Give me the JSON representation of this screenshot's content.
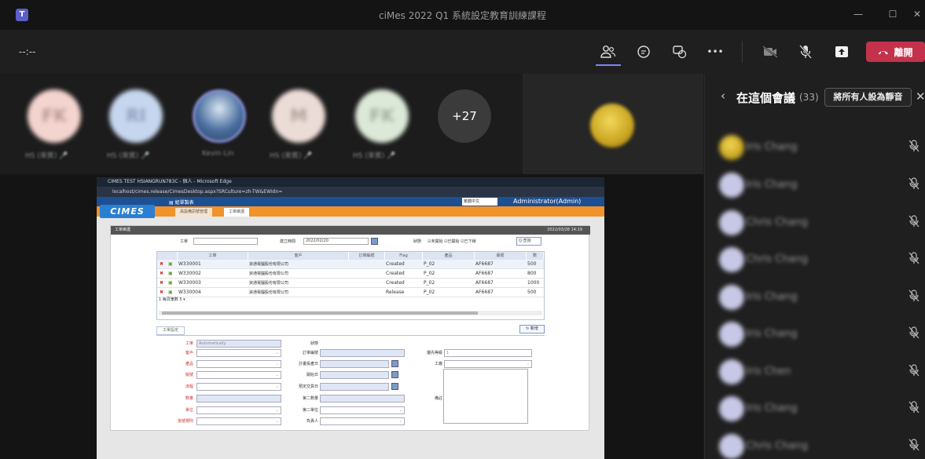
{
  "window": {
    "title": "ciMes 2022 Q1 系統設定教育訓練課程",
    "minimize": "—",
    "maximize": "☐",
    "close": "✕",
    "app_badge": "T"
  },
  "toolbar": {
    "timer": "--:--",
    "icons": [
      "people-icon",
      "chat-icon",
      "reactions-icon",
      "more-icon",
      "camera-off-icon",
      "mic-off-icon",
      "share-icon"
    ],
    "more_label": "•••",
    "leave_label": "離開",
    "accent_color": "#7f85f5",
    "leave_color": "#c4314b"
  },
  "attendees": {
    "tiles": [
      {
        "initials": "FK",
        "name": "HS (來賓) 🎤",
        "color": "#f4d4cf"
      },
      {
        "initials": "RI",
        "name": "HS (來賓) 🎤",
        "color": "#c6d6ee"
      },
      {
        "initials": "",
        "name": "Kevin Lin",
        "color": "#4a6fa0"
      },
      {
        "initials": "M",
        "name": "HS (來賓) 🎤",
        "color": "#ecdcd7"
      },
      {
        "initials": "FK",
        "name": "HS (來賓) 🎤",
        "color": "#dce8d8"
      }
    ],
    "overflow_count": "+27"
  },
  "shared_screen": {
    "browser_title": "CIMES TEST HSIANGRUN783C - 個人 - Microsoft Edge",
    "url": "localhost/cimes.release/CimesDesktop.aspx?SRCulture=zh-TW&EWIdn=",
    "menu_label": "▤ 組單製表",
    "language": "繁體中文",
    "user": "Administrator(Admin)",
    "logo": "CIMES",
    "tabs": [
      "員設備訊號管理",
      "工單維護"
    ],
    "section_title": "工單維護",
    "timestamp": "2022/03/28 14:19",
    "filters": {
      "workorder_label": "工單",
      "workorder_value": "",
      "date_label": "建立時間",
      "date_value": "2022/02/20",
      "status_label": "狀態",
      "status_options": "☑未開始 ☑已開始 ☑已下線",
      "query_label": "Q 查詢"
    },
    "grid": {
      "columns": [
        "工單",
        "客戶",
        "訂單編號",
        "Flag",
        "產品",
        "版號",
        "數"
      ],
      "rows": [
        {
          "wo": "W330001",
          "customer": "資通電腦股份有限公司",
          "order": "",
          "flag": "Created",
          "product": "P_02",
          "version": "AF6687",
          "qty": "500"
        },
        {
          "wo": "W330002",
          "customer": "資通電腦股份有限公司",
          "order": "",
          "flag": "Created",
          "product": "P_02",
          "version": "AF6687",
          "qty": "800"
        },
        {
          "wo": "W330003",
          "customer": "資通電腦股份有限公司",
          "order": "",
          "flag": "Created",
          "product": "P_02",
          "version": "AF6687",
          "qty": "1000"
        },
        {
          "wo": "W330004",
          "customer": "資通電腦股份有限公司",
          "order": "",
          "flag": "Release",
          "product": "P_02",
          "version": "AF6687",
          "qty": "500"
        }
      ],
      "pager": "1  每頁筆數 5 ▾"
    },
    "detail": {
      "tab_label": "工單設定",
      "new_label": "↻ 新增",
      "left": [
        {
          "label": "工單",
          "value": "Automatically",
          "type": "text"
        },
        {
          "label": "客戶",
          "value": "",
          "type": "select"
        },
        {
          "label": "產品",
          "value": "",
          "type": "select"
        },
        {
          "label": "版號",
          "value": "",
          "type": "select"
        },
        {
          "label": "流程",
          "value": "",
          "type": "select"
        },
        {
          "label": "數量",
          "value": "",
          "type": "text"
        },
        {
          "label": "單位",
          "value": "",
          "type": "select"
        },
        {
          "label": "批號規則",
          "value": "",
          "type": "select"
        }
      ],
      "mid": [
        {
          "label": "狀態",
          "value": "",
          "type": "none"
        },
        {
          "label": "訂單編號",
          "value": "",
          "type": "text"
        },
        {
          "label": "計畫投產日",
          "value": "",
          "type": "date"
        },
        {
          "label": "開始日",
          "value": "",
          "type": "date"
        },
        {
          "label": "預定交貨日",
          "value": "",
          "type": "date"
        },
        {
          "label": "第二數量",
          "value": "",
          "type": "text"
        },
        {
          "label": "第二單位",
          "value": "",
          "type": "select"
        },
        {
          "label": "負責人",
          "value": "",
          "type": "select"
        }
      ],
      "right": [
        {
          "label": "優先等級",
          "value": "1"
        },
        {
          "label": "工廠",
          "value": ""
        },
        {
          "label": "備註",
          "value": ""
        }
      ]
    }
  },
  "panel": {
    "title": "在這個會議",
    "count": "(33)",
    "mute_all": "將所有人設為靜音",
    "participants": [
      "Iris Chang",
      "Iris Chang",
      "Chris Chang",
      "Chris Chang",
      "Iris Chang",
      "Iris Chang",
      "Iris Chen",
      "Iris Chang",
      "Chris Chang"
    ]
  }
}
